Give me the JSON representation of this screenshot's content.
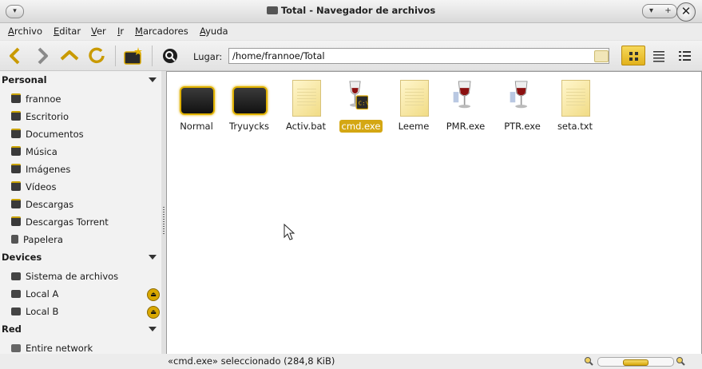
{
  "window": {
    "title": "Total - Navegador de archivos",
    "menu_button_glyph": "▾",
    "controls": {
      "minimize_glyph": "▾",
      "maximize_glyph": "+",
      "close_glyph": "✕"
    }
  },
  "menubar": {
    "items": [
      {
        "underline": "A",
        "rest": "rchivo"
      },
      {
        "underline": "E",
        "rest": "ditar"
      },
      {
        "underline": "V",
        "rest": "er"
      },
      {
        "underline": "I",
        "rest": "r"
      },
      {
        "underline": "M",
        "rest": "arcadores"
      },
      {
        "underline": "A",
        "rest": "yuda"
      }
    ]
  },
  "toolbar": {
    "location_label": "Lugar:",
    "location_value": "/home/frannoe/Total",
    "icons": [
      "back-icon",
      "forward-icon",
      "up-icon",
      "reload-icon",
      "new-folder-icon",
      "search-icon"
    ],
    "views": [
      "icon-view",
      "list-view",
      "compact-view"
    ],
    "active_view": "icon-view"
  },
  "sidebar": {
    "sections": [
      {
        "title": "Personal",
        "items": [
          "frannoe",
          "Escritorio",
          "Documentos",
          "Música",
          "Imágenes",
          "Vídeos",
          "Descargas",
          "Descargas Torrent",
          "Papelera"
        ]
      },
      {
        "title": "Devices",
        "items": [
          "Sistema de archivos",
          "Local A",
          "Local B"
        ]
      },
      {
        "title": "Red",
        "items": [
          "Entire network"
        ]
      }
    ],
    "eject_glyph": "⏏"
  },
  "files": [
    {
      "name": "Normal",
      "kind": "folder"
    },
    {
      "name": "Tryuycks",
      "kind": "folder"
    },
    {
      "name": "Activ.bat",
      "kind": "document"
    },
    {
      "name": "cmd.exe",
      "kind": "wine-exe",
      "selected": true
    },
    {
      "name": "Leeme",
      "kind": "document"
    },
    {
      "name": "PMR.exe",
      "kind": "wine-exe"
    },
    {
      "name": "PTR.exe",
      "kind": "wine-exe"
    },
    {
      "name": "seta.txt",
      "kind": "document"
    }
  ],
  "status": {
    "text": "«cmd.exe» seleccionado (284,8 KiB)",
    "zoom_level": 0.5
  },
  "colors": {
    "accent": "#d4a713",
    "selection": "#d4a713",
    "folder_border": "#e0b100"
  }
}
